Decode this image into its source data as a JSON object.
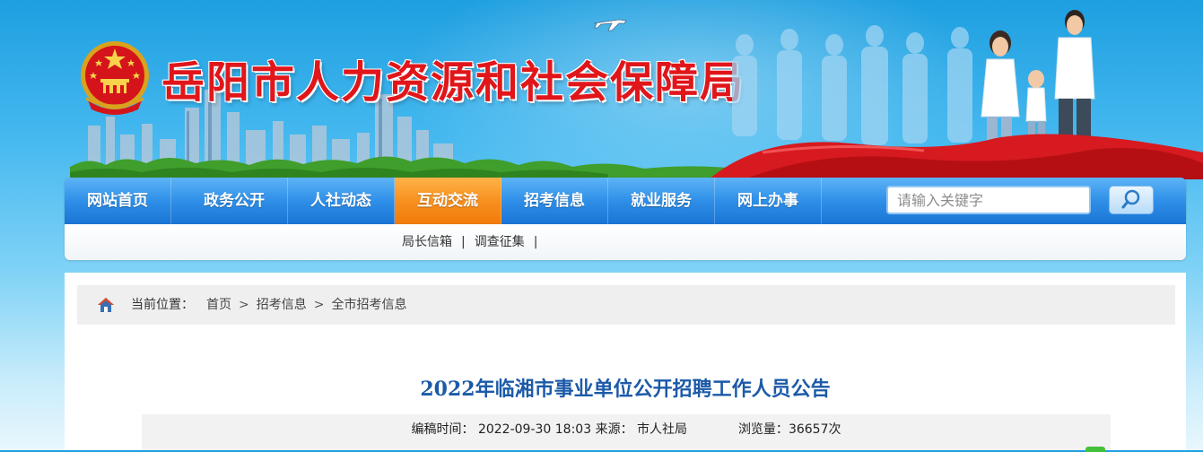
{
  "header": {
    "site_title": "岳阳市人力资源和社会保障局",
    "emblem_icon": "national-emblem-icon",
    "title_color": "#e0161b"
  },
  "nav": {
    "items": [
      {
        "label": "网站首页",
        "active": false
      },
      {
        "label": "政务公开",
        "active": false
      },
      {
        "label": "人社动态",
        "active": false
      },
      {
        "label": "互动交流",
        "active": true
      },
      {
        "label": "招考信息",
        "active": false
      },
      {
        "label": "就业服务",
        "active": false
      },
      {
        "label": "网上办事",
        "active": false
      }
    ],
    "search_placeholder": "请输入关键字",
    "search_icon": "search-icon",
    "active_color": "#f78d1c",
    "bar_color": "#2f8fe8"
  },
  "subnav": {
    "items": [
      "局长信箱",
      "调查征集"
    ],
    "separator": "|"
  },
  "breadcrumb": {
    "home_icon": "home-icon",
    "label": "当前位置：",
    "path": [
      "首页",
      "招考信息",
      "全市招考信息"
    ],
    "separator": ">"
  },
  "article": {
    "title": "2022年临湘市事业单位公开招聘工作人员公告",
    "title_color": "#1c5aa8",
    "meta": {
      "time_label": "编稿时间：",
      "time_value": "2022-09-30 18:03",
      "source_label": "来源：",
      "source_value": "市人社局",
      "views_label": "浏览量：",
      "views_value": "36657次"
    }
  }
}
